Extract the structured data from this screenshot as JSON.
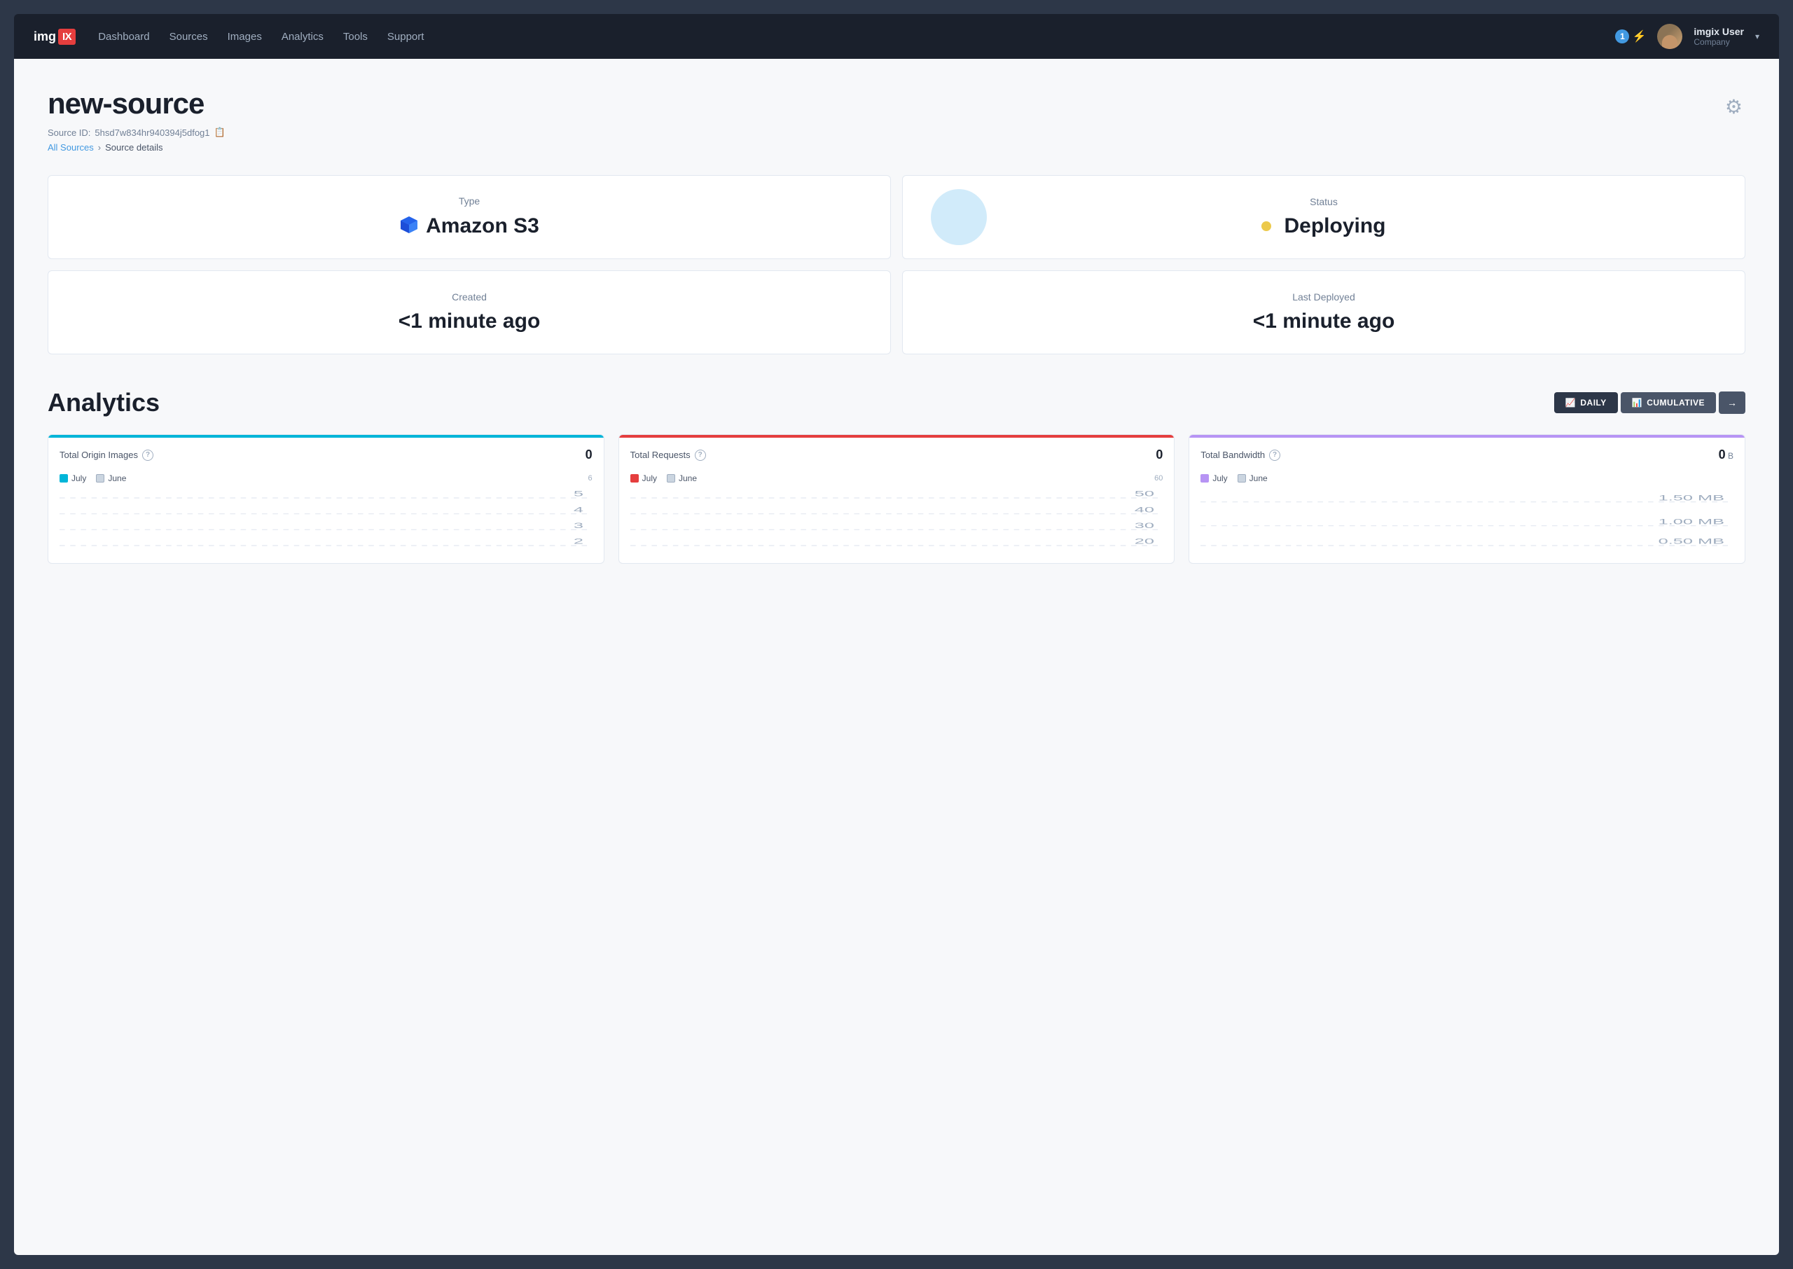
{
  "navbar": {
    "logo": "imgix",
    "logo_accent": "IX",
    "links": [
      "Dashboard",
      "Sources",
      "Images",
      "Analytics",
      "Tools",
      "Support"
    ],
    "notification_count": "1",
    "user_name": "imgix User",
    "user_company": "Company"
  },
  "page": {
    "title": "new-source",
    "source_id_label": "Source ID:",
    "source_id": "5hsd7w834hr940394j5dfog1",
    "breadcrumb_all": "All Sources",
    "breadcrumb_sep": ">",
    "breadcrumb_current": "Source details",
    "gear_label": "⚙"
  },
  "cards": [
    {
      "label": "Type",
      "value": "Amazon S3",
      "has_icon": true
    },
    {
      "label": "Status",
      "value": "Deploying",
      "status_dot": true
    },
    {
      "label": "Created",
      "value": "<1 minute ago",
      "has_icon": false
    },
    {
      "label": "Last Deployed",
      "value": "<1 minute ago",
      "has_icon": false
    }
  ],
  "analytics": {
    "title": "Analytics",
    "daily_label": "DAILY",
    "cumulative_label": "CUMULATIVE",
    "arrow_label": "→",
    "charts": [
      {
        "id": "origin-images",
        "title": "Total Origin Images",
        "value": "0",
        "color": "blue",
        "legend_july": "July",
        "legend_june": "June",
        "y_labels": [
          "6",
          "5",
          "4",
          "3"
        ],
        "bar_color": "#00b5d8"
      },
      {
        "id": "requests",
        "title": "Total Requests",
        "value": "0",
        "color": "orange",
        "legend_july": "July",
        "legend_june": "June",
        "y_labels": [
          "60",
          "50",
          "40",
          "30"
        ],
        "bar_color": "#e53e3e"
      },
      {
        "id": "bandwidth",
        "title": "Total Bandwidth",
        "value": "0",
        "value_unit": "B",
        "color": "purple",
        "legend_july": "July",
        "legend_june": "June",
        "y_labels": [
          "1.50 MB",
          "1.00 MB"
        ],
        "bar_color": "#b794f4"
      }
    ]
  }
}
